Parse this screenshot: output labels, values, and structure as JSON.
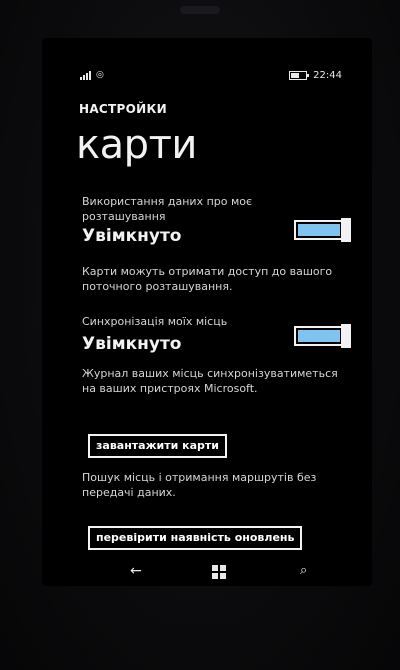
{
  "status_bar": {
    "time": "22:44",
    "icons": [
      "signal-icon",
      "data-icon",
      "battery-icon"
    ]
  },
  "header": {
    "app_name": "НАСТРОЙКИ",
    "page_title": "карти"
  },
  "settings": [
    {
      "label": "Використання даних про моє розташування",
      "value": "Увімкнуто",
      "description": "Карти можуть отримати доступ до вашого поточного розташування.",
      "toggle_on": true
    },
    {
      "label": "Синхронізація моїх місць",
      "value": "Увімкнуто",
      "description": "Журнал ваших місць синхронізуватиметься на ваших пристроях Microsoft.",
      "toggle_on": true
    }
  ],
  "download": {
    "button_label": "завантажити карти",
    "description": "Пошук місць і отримання маршрутів без передачі даних."
  },
  "updates": {
    "button_label": "перевірити наявність оновлень"
  },
  "nav": {
    "icons": [
      "back-icon",
      "windows-start-icon",
      "search-icon"
    ]
  },
  "colors": {
    "background": "#000000",
    "text": "#f2f2f2",
    "toggle_accent": "#7fc4f0"
  }
}
